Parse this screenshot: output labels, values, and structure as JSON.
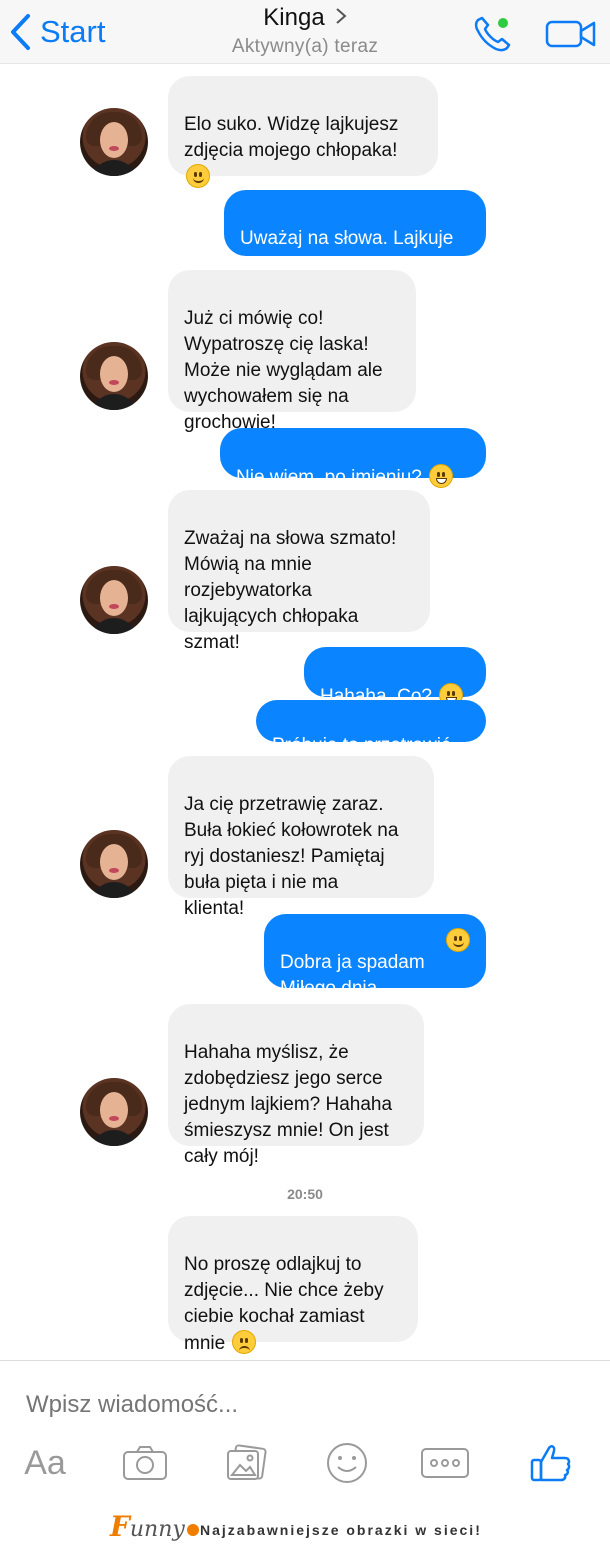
{
  "header": {
    "back_label": "Start",
    "contact_name": "Kinga",
    "status": "Aktywny(a) teraz",
    "colors": {
      "accent": "#0b7cf5",
      "online": "#2ecc40"
    },
    "icons": [
      "back-chevron-icon",
      "phone-icon",
      "video-camera-icon",
      "chevron-right-icon"
    ]
  },
  "messages": [
    {
      "from": "them",
      "text": "Elo  suko. Widzę lajkujesz\nzdjęcia mojego chłopaka!\n",
      "emoji": "smile"
    },
    {
      "from": "me",
      "text": "Uważaj na słowa. Lajkuje\na co?"
    },
    {
      "from": "them",
      "text": "Już ci mówię co!\nWypatroszę cię laska!\nMoże nie wyglądam ale\nwychowałem się na\ngrochowie!"
    },
    {
      "from": "me",
      "text": "Nie wiem, po imieniu? ",
      "emoji": "grin"
    },
    {
      "from": "them",
      "text": "Zważaj na słowa szmato!\nMówią na mnie\nrozjebywatorka\nlajkujących chłopaka\nszmat!"
    },
    {
      "from": "me",
      "text": "Hahaha. Co? ",
      "emoji": "grin"
    },
    {
      "from": "me",
      "text": "Próbuję to przetrawić"
    },
    {
      "from": "them",
      "text": "Ja cię przetrawię zaraz.\nBuła łokieć kołowrotek na\nryj dostaniesz! Pamiętaj\nbuła pięta i nie ma\nklienta!"
    },
    {
      "from": "me",
      "text": "Dobra ja spadam \nMiłego dnia",
      "emoji": "smile"
    },
    {
      "from": "them",
      "text": "Hahaha myślisz, że\nzdobędziesz jego serce\njednym lajkiem? Hahaha\nśmieszysz mnie! On jest\ncały mój!"
    },
    {
      "from": "them",
      "text": "No proszę odlajkuj to\nzdjęcie... Nie chce żeby\nciebie kochał zamiast\nmnie ",
      "emoji": "sad"
    }
  ],
  "timestamp": "20:50",
  "composer": {
    "placeholder": "Wpisz wiadomość...",
    "aa_label": "Aa",
    "icons": [
      "camera-icon",
      "gallery-icon",
      "emoji-icon",
      "more-icon",
      "thumbs-up-icon"
    ]
  },
  "footer": {
    "logo_text": "unny",
    "logo_initial": "F",
    "tagline": "Najzabawniejsze obrazki w sieci!"
  },
  "colors": {
    "incoming_bubble": "#f0f0f0",
    "outgoing_bubble": "#0b84ff"
  }
}
